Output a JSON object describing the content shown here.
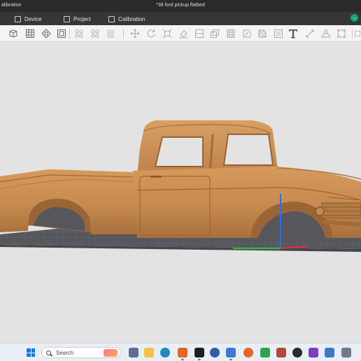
{
  "window": {
    "app_title": "alibration",
    "file_title": "*38 ford pickup flatbed"
  },
  "menu": {
    "tabs": [
      {
        "label": "Device",
        "icon": "device-icon"
      },
      {
        "label": "Project",
        "icon": "project-icon"
      },
      {
        "label": "Calibration",
        "icon": "calibration-icon"
      }
    ]
  },
  "toolbar": {
    "tools": [
      "add-object-icon",
      "grid-icon",
      "arrange-icon",
      "orient-icon",
      "auto-layout-icon",
      "split-icon",
      "layers-icon",
      "move-icon",
      "rotate-icon",
      "scale-icon",
      "lay-flat-icon",
      "cut-icon",
      "boolean-icon",
      "paint-icon",
      "seam-icon",
      "support-paint-icon",
      "fuzzy-skin-icon",
      "measure-icon",
      "text-icon",
      "emboss-icon",
      "assembly-icon"
    ]
  },
  "taskbar": {
    "search_placeholder": "Search"
  },
  "colors": {
    "titlebar": "#2a2a2a",
    "menubar": "#363636",
    "accent": "#10a37f",
    "model": "#c98d52",
    "bed": "#55575c",
    "axis_x": "#d9303a",
    "axis_y": "#3ab04a",
    "axis_z": "#2f6fd8"
  }
}
